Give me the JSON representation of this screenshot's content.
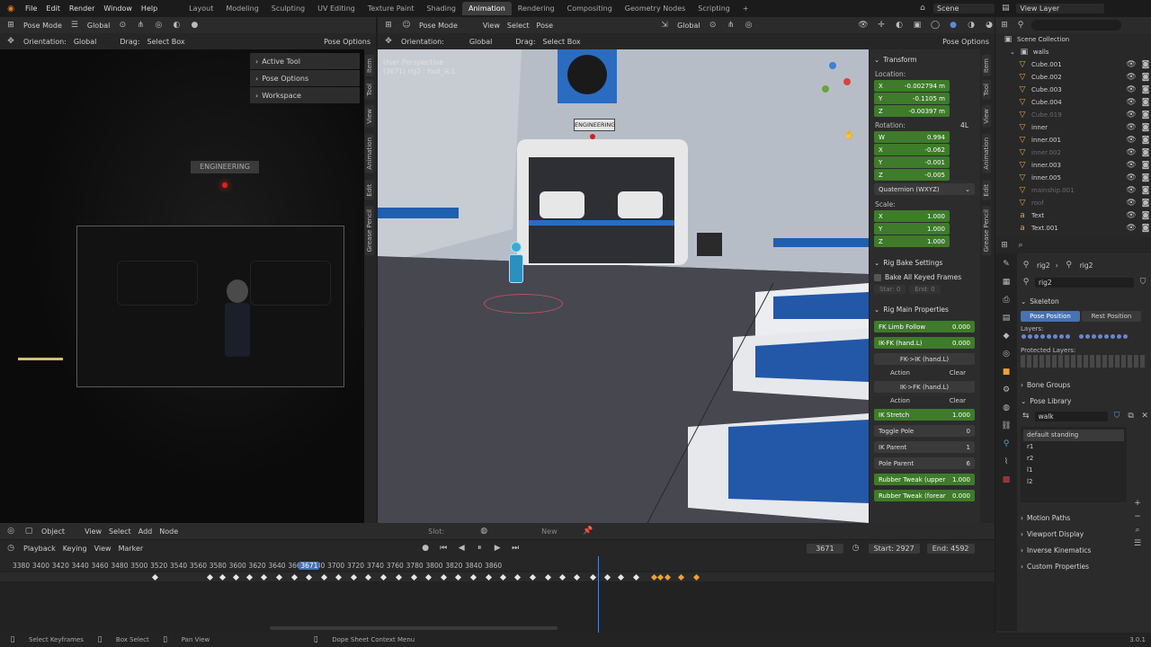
{
  "menu": {
    "items": [
      "File",
      "Edit",
      "Render",
      "Window",
      "Help"
    ]
  },
  "workspaces": [
    "Layout",
    "Modeling",
    "Sculpting",
    "UV Editing",
    "Texture Paint",
    "Shading",
    "Animation",
    "Rendering",
    "Compositing",
    "Geometry Nodes",
    "Scripting"
  ],
  "workspace_active": "Animation",
  "scene": {
    "scene_label": "Scene",
    "view_layer_label": "View Layer"
  },
  "left_viewport": {
    "mode": "Pose Mode",
    "orientation_label": "Orientation:",
    "orientation_value": "Global",
    "drag_label": "Drag:",
    "drag_value": "Select Box",
    "transform_value": "Global",
    "pose_options": "Pose Options",
    "panels": [
      "Active Tool",
      "Pose Options",
      "Workspace"
    ],
    "sign_text": "ENGINEERING"
  },
  "main_viewport": {
    "mode": "Pose Mode",
    "menu": [
      "View",
      "Select",
      "Pose"
    ],
    "transform_value": "Global",
    "orientation_label": "Orientation:",
    "orientation_value": "Global",
    "drag_label": "Drag:",
    "drag_value": "Select Box",
    "pose_options": "Pose Options",
    "perspective": "User Perspective",
    "object_info": "(3671) rig2 : foot_ik.L",
    "sign_text": "ENGINEERING",
    "tabs": [
      "Item",
      "Tool",
      "View",
      "Animation",
      "Edit",
      "Grease Pencil"
    ]
  },
  "n_panel": {
    "transform_title": "Transform",
    "location_label": "Location:",
    "location": [
      {
        "axis": "X",
        "value": "-0.002794 m"
      },
      {
        "axis": "Y",
        "value": "-0.1105 m"
      },
      {
        "axis": "Z",
        "value": "-0.00397 m"
      }
    ],
    "rotation_label": "Rotation:",
    "rotation_mode_badge": "4L",
    "rotation": [
      {
        "axis": "W",
        "value": "0.994"
      },
      {
        "axis": "X",
        "value": "-0.062"
      },
      {
        "axis": "Y",
        "value": "-0.001"
      },
      {
        "axis": "Z",
        "value": "-0.005"
      }
    ],
    "rotation_mode": "Quaternion (WXYZ)",
    "scale_label": "Scale:",
    "scale": [
      {
        "axis": "X",
        "value": "1.000"
      },
      {
        "axis": "Y",
        "value": "1.000"
      },
      {
        "axis": "Z",
        "value": "1.000"
      }
    ],
    "bake_title": "Rig Bake Settings",
    "bake_all": "Bake All Keyed Frames",
    "bake_start": "Star: 0",
    "bake_end": "End: 0",
    "rig_props_title": "Rig Main Properties",
    "fk_limb_follow": {
      "label": "FK Limb Follow",
      "value": "0.000"
    },
    "ikfk": {
      "label": "IK-FK (hand.L)",
      "value": "0.000"
    },
    "fk_to_ik": "FK->IK (hand.L)",
    "ik_to_fk": "IK->FK (hand.L)",
    "action_label": "Action",
    "clear_label": "Clear",
    "ik_stretch": {
      "label": "IK Stretch",
      "value": "1.000"
    },
    "toggle_pole": {
      "label": "Toggle Pole",
      "value": "0"
    },
    "ik_parent": {
      "label": "IK Parent",
      "value": "1"
    },
    "pole_parent": {
      "label": "Pole Parent",
      "value": "6"
    },
    "rubber_upper": {
      "label": "Rubber Tweak (upper",
      "value": "1.000"
    },
    "rubber_fore": {
      "label": "Rubber Tweak (forear",
      "value": "0.000"
    }
  },
  "outliner": {
    "root": "Scene Collection",
    "collection": "walls",
    "items": [
      {
        "name": "Cube.001",
        "dim": false
      },
      {
        "name": "Cube.002",
        "dim": false
      },
      {
        "name": "Cube.003",
        "dim": false
      },
      {
        "name": "Cube.004",
        "dim": false
      },
      {
        "name": "Cube.019",
        "dim": true
      },
      {
        "name": "inner",
        "dim": false
      },
      {
        "name": "inner.001",
        "dim": false
      },
      {
        "name": "inner.002",
        "dim": true
      },
      {
        "name": "inner.003",
        "dim": false
      },
      {
        "name": "inner.005",
        "dim": false
      },
      {
        "name": "mainship.001",
        "dim": true
      },
      {
        "name": "roof",
        "dim": true
      },
      {
        "name": "Text",
        "dim": false
      },
      {
        "name": "Text.001",
        "dim": false
      }
    ]
  },
  "properties": {
    "breadcrumb_a": "rig2",
    "breadcrumb_b": "rig2",
    "armature_name": "rig2",
    "skeleton": "Skeleton",
    "pose_position": "Pose Position",
    "rest_position": "Rest Position",
    "layers_label": "Layers:",
    "protected_label": "Protected Layers:",
    "bone_groups": "Bone Groups",
    "pose_library": "Pose Library",
    "pose_lib_name": "walk",
    "poses": [
      "default standing",
      "r1",
      "r2",
      "l1",
      "l2"
    ],
    "sections": [
      "Motion Paths",
      "Viewport Display",
      "Inverse Kinematics",
      "Custom Properties"
    ]
  },
  "node_header": {
    "object": "Object",
    "menu": [
      "View",
      "Select",
      "Add",
      "Node"
    ],
    "slot": "Slot:",
    "new": "New"
  },
  "timeline": {
    "playback": "Playback",
    "keying": "Keying",
    "view": "View",
    "marker": "Marker",
    "current_frame": "3671",
    "start": "Start: 2927",
    "end": "End: 4592",
    "ticks": [
      "3380",
      "3400",
      "3420",
      "3440",
      "3460",
      "3480",
      "3500",
      "3520",
      "3540",
      "3560",
      "3580",
      "3600",
      "3620",
      "3640",
      "3660",
      "3671",
      "3680",
      "3700",
      "3720",
      "3740",
      "3760",
      "3780",
      "3800",
      "3820",
      "3840",
      "3860"
    ]
  },
  "status": {
    "items": [
      "Select Keyframes",
      "Box Select",
      "Pan View",
      "Dope Sheet Context Menu"
    ],
    "version": "3.0.1"
  },
  "colors": {
    "accent": "#4772b3",
    "green_field": "#3e7b2a",
    "orange_key": "#e8a23a",
    "panel": "#2c2c2c"
  }
}
